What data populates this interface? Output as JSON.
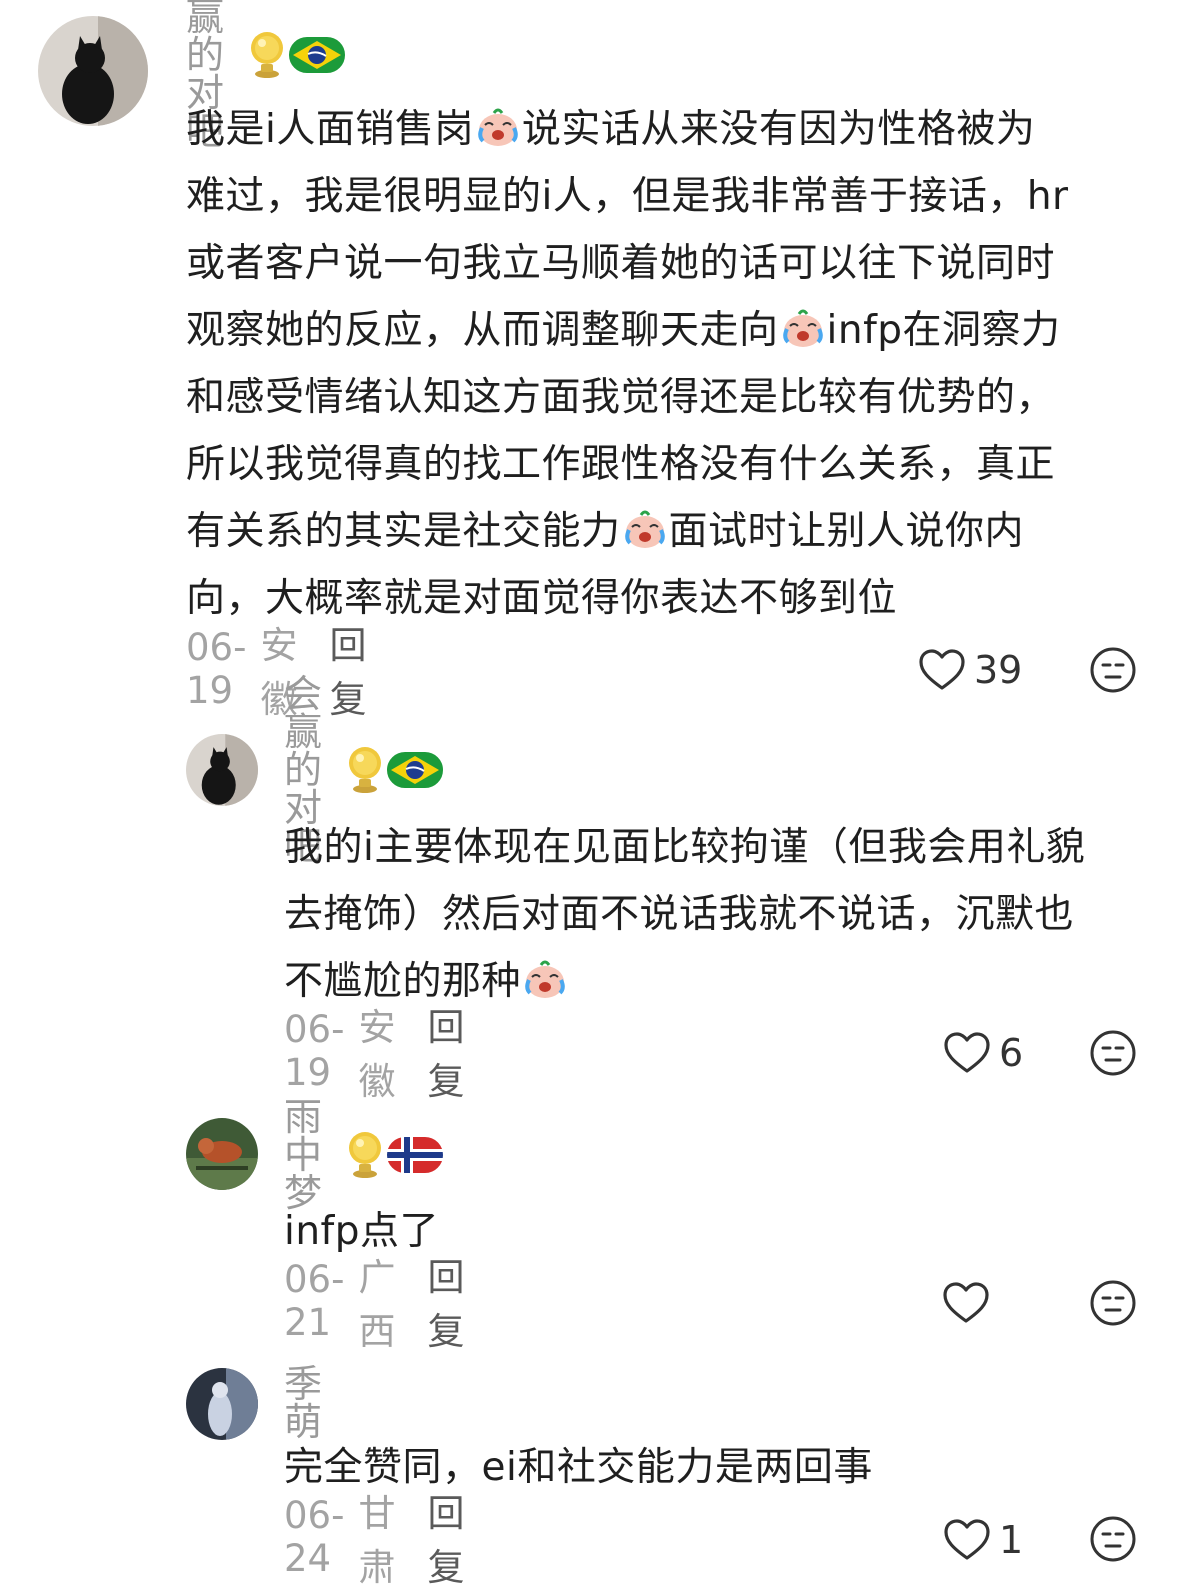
{
  "comments": [
    {
      "username": "会赢的对吧",
      "lines": [
        {
          "a": "我是i人面销售岗",
          "b": "说实话从来没有因为性格被为"
        },
        {
          "a": "难过，我是很明显的i人，但是我非常善于接话，hr",
          "b": ""
        },
        {
          "a": "或者客户说一句我立马顺着她的话可以往下说同时",
          "b": ""
        },
        {
          "a": "观察她的反应，从而调整聊天走向",
          "b": "infp在洞察力"
        },
        {
          "a": "和感受情绪认知这方面我觉得还是比较有优势的，",
          "b": ""
        },
        {
          "a": "所以我觉得真的找工作跟性格没有什么关系，真正",
          "b": ""
        },
        {
          "a": "有关系的其实是社交能力",
          "b": "面试时让别人说你内"
        },
        {
          "a": "向，大概率就是对面觉得你表达不够到位",
          "b": ""
        }
      ],
      "date": "06-19",
      "region": "安徽",
      "reply": "回复",
      "likes": "39"
    },
    {
      "username": "会赢的对吧",
      "lines": [
        {
          "a": "我的i主要体现在见面比较拘谨（但我会用礼貌",
          "b": ""
        },
        {
          "a": "去掩饰）然后对面不说话我就不说话，沉默也",
          "b": ""
        },
        {
          "a": "不尴尬的那种",
          "b": ""
        }
      ],
      "date": "06-19",
      "region": "安徽",
      "reply": "回复",
      "likes": "6"
    },
    {
      "username": "雨中梦",
      "lines": [
        {
          "a": "infp点了",
          "b": ""
        }
      ],
      "date": "06-21",
      "region": "广西",
      "reply": "回复",
      "likes": ""
    },
    {
      "username": "季萌",
      "lines": [
        {
          "a": "完全赞同，ei和社交能力是两回事",
          "b": ""
        }
      ],
      "date": "06-24",
      "region": "甘肃",
      "reply": "回复",
      "likes": "1"
    }
  ],
  "icons": {
    "badge_trophy": "trophy-icon",
    "flag_brazil": "brazil-flag-icon",
    "flag_norway": "norway-flag-icon",
    "emoji": "crying-laughing-emoji-icon",
    "like": "heart-outline-icon",
    "dislike": "neutral-face-icon"
  },
  "colors": {
    "username": "#9a9a9a",
    "text": "#1f1f1f",
    "meta": "#a3a3a3",
    "reply": "#5a5a5a"
  }
}
